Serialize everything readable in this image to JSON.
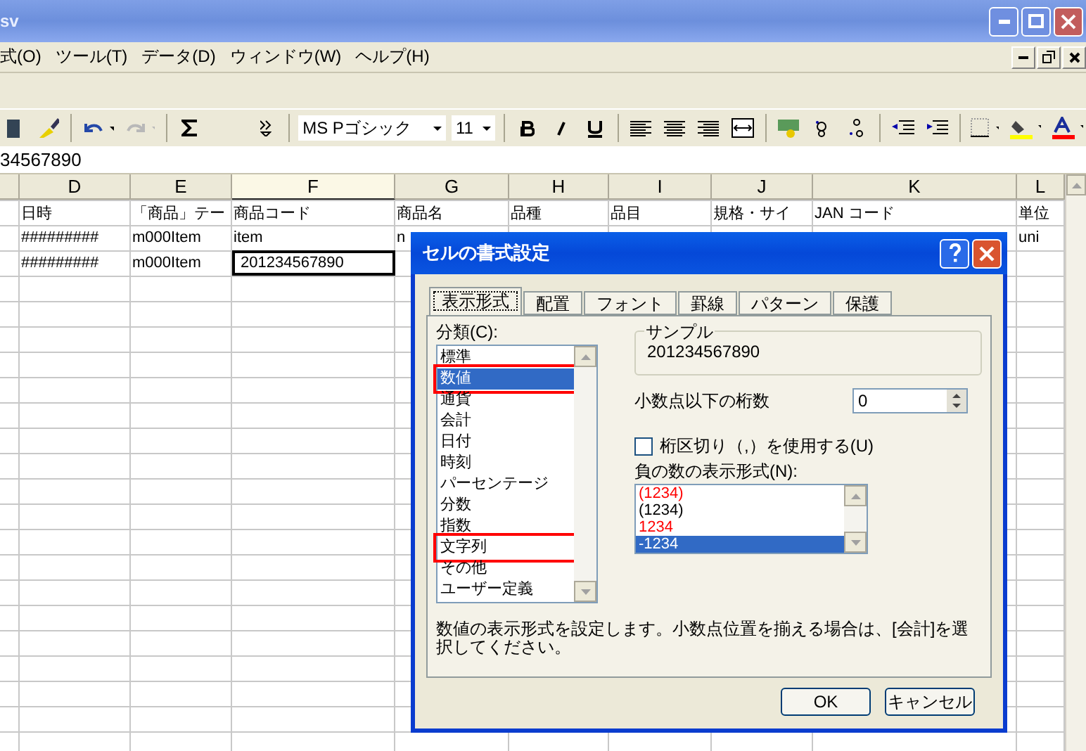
{
  "window": {
    "title": "sv"
  },
  "menu": [
    "式(O)",
    "ツール(T)",
    "データ(D)",
    "ウィンドウ(W)",
    "ヘルプ(H)"
  ],
  "toolbar": {
    "font": "MS Pゴシック",
    "size": "11"
  },
  "formula_bar": {
    "value": "34567890"
  },
  "columns": [
    {
      "selected": false
    },
    {
      "label": "D",
      "selected": false
    },
    {
      "label": "E",
      "selected": false
    },
    {
      "label": "F",
      "selected": true
    },
    {
      "label": "G",
      "selected": false
    },
    {
      "label": "H",
      "selected": false
    },
    {
      "label": "I",
      "selected": false
    },
    {
      "label": "J",
      "selected": false
    },
    {
      "label": "K",
      "selected": false
    },
    {
      "label": "L",
      "selected": false
    }
  ],
  "rows": [
    [
      {
        "text": ""
      },
      {
        "text": "日時"
      },
      {
        "text": "「商品」テー"
      },
      {
        "text": "商品コード"
      },
      {
        "text": "商品名"
      },
      {
        "text": "品種"
      },
      {
        "text": "品目"
      },
      {
        "text": "規格・サイ"
      },
      {
        "text": "JAN コード"
      },
      {
        "text": "単位"
      }
    ],
    [
      {
        "text": ""
      },
      {
        "text": "#########"
      },
      {
        "text": "m000Item"
      },
      {
        "text": "item"
      },
      {
        "text": "n"
      },
      {
        "text": ""
      },
      {
        "text": ""
      },
      {
        "text": ""
      },
      {
        "text": ""
      },
      {
        "text": "uni"
      }
    ],
    [
      {
        "text": ""
      },
      {
        "text": "#########"
      },
      {
        "text": "m000Item"
      },
      {
        "text": "201234567890",
        "selected": true
      },
      {
        "text": ""
      },
      {
        "text": ""
      },
      {
        "text": ""
      },
      {
        "text": ""
      },
      {
        "text": ""
      },
      {
        "text": ""
      }
    ]
  ],
  "dialog": {
    "title": "セルの書式設定",
    "tabs": [
      {
        "label": "表示形式",
        "selected": true
      },
      {
        "label": "配置",
        "selected": false
      },
      {
        "label": "フォント",
        "selected": false
      },
      {
        "label": "罫線",
        "selected": false
      },
      {
        "label": "パターン",
        "selected": false
      },
      {
        "label": "保護",
        "selected": false
      }
    ],
    "category_label": "分類(C):",
    "categories": [
      {
        "label": "標準",
        "selected": false,
        "highlighted": false
      },
      {
        "label": "数値",
        "selected": true,
        "highlighted": true
      },
      {
        "label": "通貨",
        "selected": false,
        "highlighted": false
      },
      {
        "label": "会計",
        "selected": false,
        "highlighted": false
      },
      {
        "label": "日付",
        "selected": false,
        "highlighted": false
      },
      {
        "label": "時刻",
        "selected": false,
        "highlighted": false
      },
      {
        "label": "パーセンテージ",
        "selected": false,
        "highlighted": false
      },
      {
        "label": "分数",
        "selected": false,
        "highlighted": false
      },
      {
        "label": "指数",
        "selected": false,
        "highlighted": false
      },
      {
        "label": "文字列",
        "selected": false,
        "highlighted": true
      },
      {
        "label": "その他",
        "selected": false,
        "highlighted": false
      },
      {
        "label": "ユーザー定義",
        "selected": false,
        "highlighted": false
      }
    ],
    "sample_label": "サンプル",
    "sample": "201234567890",
    "decimals_label": "小数点以下の桁数",
    "decimals": "0",
    "separator": {
      "label": "桁区切り（,）を使用する(U)",
      "checked": false
    },
    "negative_label": "負の数の表示形式(N):",
    "negative_formats": [
      {
        "label": "(1234)",
        "red": true,
        "selected": false
      },
      {
        "label": "(1234)",
        "red": false,
        "selected": false
      },
      {
        "label": "1234",
        "red": true,
        "selected": false
      },
      {
        "label": "-1234",
        "red": false,
        "selected": true
      }
    ],
    "description": "数値の表示形式を設定します。小数点位置を揃える場合は、[会計]を選択してください。",
    "buttons": [
      "OK",
      "キャンセル"
    ]
  }
}
